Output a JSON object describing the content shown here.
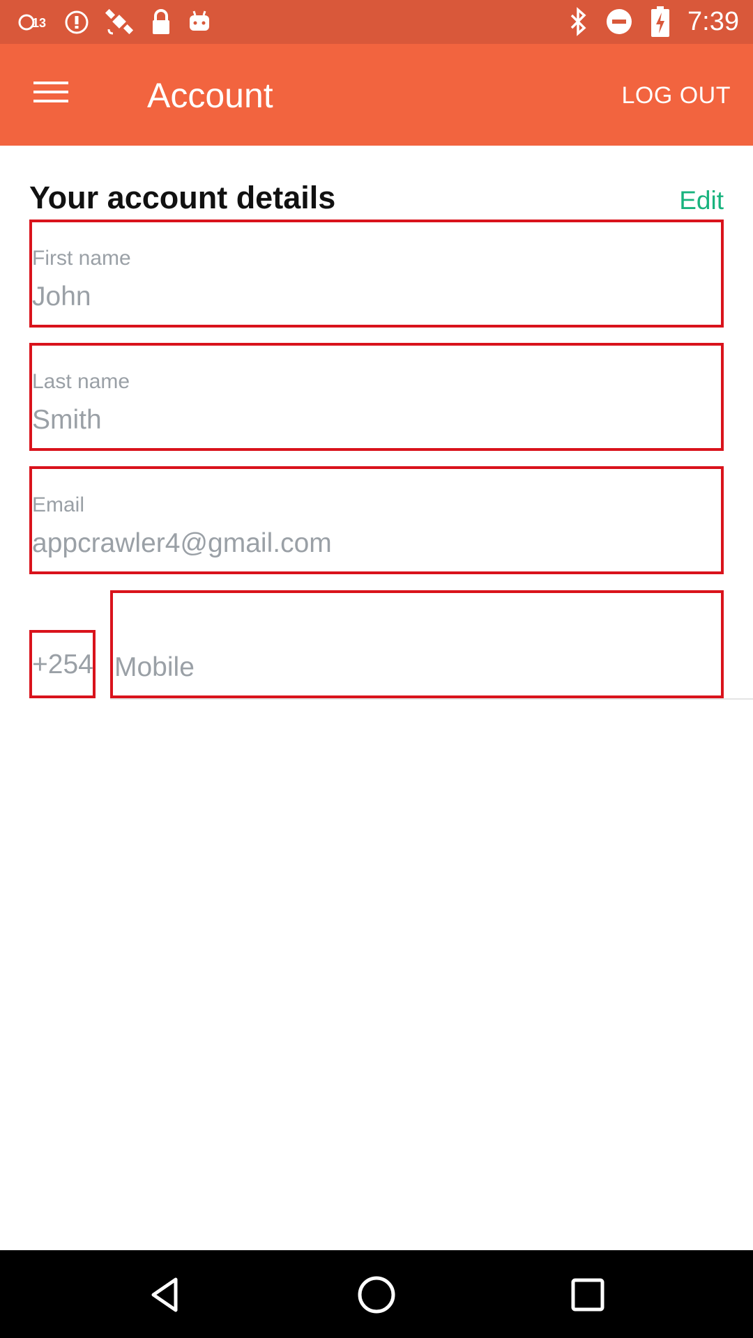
{
  "status_bar": {
    "time": "7:39",
    "left_icons": [
      "abc13-icon",
      "alert-icon",
      "fake-gps-icon",
      "lock-icon",
      "android-icon"
    ],
    "right_icons": [
      "bluetooth-icon",
      "do-not-disturb-icon",
      "battery-charging-icon"
    ],
    "background_color": "#d9583a"
  },
  "app_bar": {
    "title": "Account",
    "logout_label": "LOG OUT",
    "background_color": "#f2643f"
  },
  "account": {
    "section_title": "Your account details",
    "edit_label": "Edit",
    "edit_color": "#18b37e",
    "fields": [
      {
        "label": "First name",
        "value": "John"
      },
      {
        "label": "Last name",
        "value": "Smith"
      },
      {
        "label": "Email",
        "value": "appcrawler4@gmail.com"
      }
    ],
    "phone": {
      "country_code": "+254",
      "placeholder": "Mobile"
    }
  },
  "highlight_color": "#d9131c",
  "nav_bar": {
    "buttons": [
      "back-icon",
      "home-icon",
      "recents-icon"
    ]
  }
}
